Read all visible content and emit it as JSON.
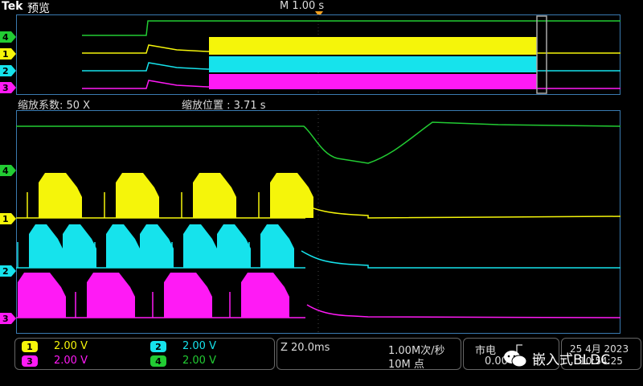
{
  "header": {
    "brand": "Tek",
    "mode": "预览",
    "timebase": "M 1.00 s"
  },
  "zoom": {
    "factor_label": "缩放系数: 50 X",
    "position_label": "缩放位置 : 3.71 s"
  },
  "channels": [
    {
      "id": "1",
      "color": "#f5f50a",
      "scale": "2.00 V"
    },
    {
      "id": "2",
      "color": "#16e3ec",
      "scale": "2.00 V"
    },
    {
      "id": "3",
      "color": "#ff1af5",
      "scale": "2.00 V"
    },
    {
      "id": "4",
      "color": "#22cc33",
      "scale": "2.00 V"
    }
  ],
  "readouts": {
    "zoom_time": "Z 20.0ms",
    "sample_rate": "1.00M次/秒",
    "record_length": "10M 点",
    "trigger_source": "市电",
    "trigger_level": "0.00",
    "date": "25 4月 2023",
    "time": "10:54:25"
  },
  "watermark": "嵌入式BLDC"
}
